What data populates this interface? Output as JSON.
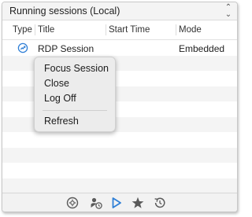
{
  "sessions_dropdown": {
    "selected": "Running sessions (Local)"
  },
  "table": {
    "columns": [
      "Type",
      "Title",
      "Start Time",
      "Mode"
    ],
    "rows": [
      {
        "type_icon": "rdp-session-icon",
        "title": "RDP Session",
        "start_time": "",
        "mode": "Embedded"
      }
    ]
  },
  "context_menu": {
    "items": [
      "Focus Session",
      "Close",
      "Log Off",
      "Refresh"
    ]
  },
  "toolbar": {
    "buttons": [
      "clock-settings-icon",
      "user-session-icon",
      "play-icon",
      "star-icon",
      "history-icon"
    ]
  },
  "colors": {
    "accent": "#2f7fd6",
    "icon_gray": "#5a5a5a"
  }
}
